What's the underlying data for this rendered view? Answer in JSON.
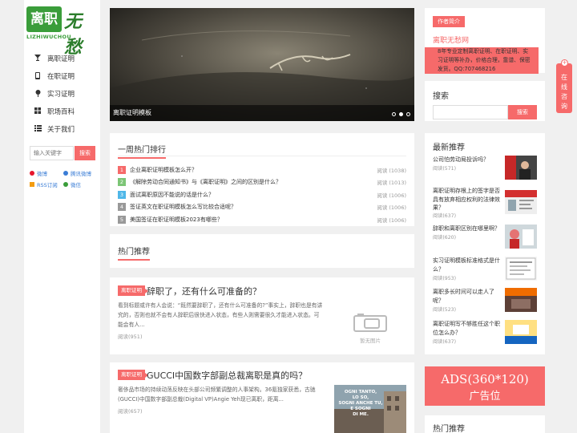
{
  "brand": {
    "logo_text": "离职",
    "logo_script": "无愁",
    "logo_sub": "LIZHIWUCHOU"
  },
  "sidebar": {
    "nav": [
      {
        "label": "离职证明",
        "icon": "glass-icon"
      },
      {
        "label": "在职证明",
        "icon": "phone-icon"
      },
      {
        "label": "实习证明",
        "icon": "pin-icon"
      },
      {
        "label": "职场百科",
        "icon": "grid-icon"
      },
      {
        "label": "关于我们",
        "icon": "list-icon"
      }
    ],
    "search_placeholder": "输入关键字",
    "search_button": "搜索",
    "follow": [
      {
        "label": "微博",
        "color": "#e6162d"
      },
      {
        "label": "腾讯微博",
        "color": "#3a7dd6"
      },
      {
        "label": "RSS订阅",
        "color": "#f39c12"
      },
      {
        "label": "微信",
        "color": "#3a9d3a"
      }
    ]
  },
  "slider": {
    "caption": "离职证明模板",
    "dot_count": 3,
    "active_dot": 2
  },
  "hot_week": {
    "title": "一周热门排行",
    "items": [
      {
        "rank": "1",
        "title": "企业离职证明模板怎么开？",
        "read": "阅读 (1038)"
      },
      {
        "rank": "2",
        "title": "《解除劳动合同通知书》与《离职证明》之间的区别是什么？",
        "read": "阅读 (1013)"
      },
      {
        "rank": "3",
        "title": "面试离职原因不能说的话是什么？",
        "read": "阅读 (1006)"
      },
      {
        "rank": "4",
        "title": "签证英文在职证明模板怎么写比较合适呢？",
        "read": "阅读 (1006)"
      },
      {
        "rank": "5",
        "title": "美国签证在职证明模板2023有哪些？",
        "read": "阅读 (1006)"
      }
    ],
    "rank_colors": [
      "#f66a6a",
      "#7cc576",
      "#4fb7e8",
      "#999999",
      "#999999"
    ]
  },
  "hot_recommend": {
    "title": "热门推荐"
  },
  "articles": [
    {
      "tag": "离职证明",
      "title": "辞职了，还有什么可准备的？",
      "excerpt_lines": [
        "看到标题或许有人会说：“既然要辞职了，还有什么可准备的?”事实上，辞职也是有讲",
        "究的，否则也就不会有人辞职后很快进入状态，有些人则需要很久才能进入状态。可",
        "能会有人..."
      ],
      "read": "阅读(951)",
      "no_image_text": "暂无图片"
    },
    {
      "tag": "离职证明",
      "title": "GUCCI中国数字部副总裁离职是真的吗？",
      "excerpt_lines": [
        "奢侈品市场的持续动荡反映在头部公司频繁调整的人事架构。36氪独家获悉，古驰",
        "(GUCCI)中国数字部副总裁(Digital VP)Angie Yeh现已离职，距离..."
      ],
      "read": "阅读(657)",
      "image_text": [
        "OGNI TANTO,",
        "LO SO,",
        "SOGNI ANCHE TU,",
        "E SOGNI",
        "DI ME."
      ]
    }
  ],
  "author": {
    "badge": "作者简介",
    "name": "离职无愁网",
    "desc_lines": [
      "8年专业定制离职证明、在职证明、实",
      "习证明等补办，价格合理，靠谱、保密",
      "发货。QQ:707468216"
    ]
  },
  "right_search": {
    "title": "搜索",
    "button": "搜索"
  },
  "latest": {
    "title": "最新推荐",
    "items": [
      {
        "title": "公司怕劳动局投诉吗？",
        "read": "阅读(571)"
      },
      {
        "title": "离职证明存根上的签字是否具有放弃相应权利的法律效果？",
        "read": "阅读(637)"
      },
      {
        "title": "辞职和离职区别在哪里啊？",
        "read": "阅读(620)"
      },
      {
        "title": "实习证明模板标准格式是什么？",
        "read": "阅读(953)"
      },
      {
        "title": "离职多长时间可以走人了呢？",
        "read": "阅读(523)"
      },
      {
        "title": "离职证明写不够胜任这个职位怎么办？",
        "read": "阅读(637)"
      }
    ]
  },
  "ads": {
    "line1": "ADS(360*120)",
    "line2": "广告位"
  },
  "right_hot": {
    "title": "热门推荐"
  },
  "consult": {
    "text": "在线咨询",
    "plus": "+"
  }
}
